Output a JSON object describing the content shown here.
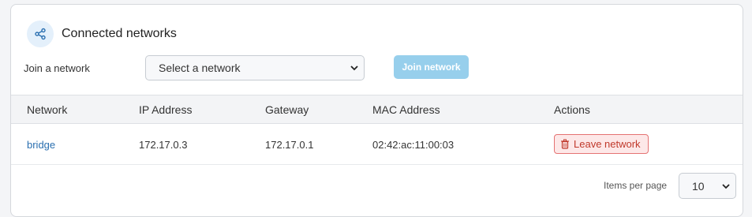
{
  "section": {
    "title": "Connected networks",
    "icon": "share-nodes-icon"
  },
  "join": {
    "label": "Join a network",
    "select_value": "Select a network",
    "button_label": "Join network"
  },
  "table": {
    "columns": [
      "Network",
      "IP Address",
      "Gateway",
      "MAC Address",
      "Actions"
    ],
    "rows": [
      {
        "network": "bridge",
        "ip": "172.17.0.3",
        "gateway": "172.17.0.1",
        "mac": "02:42:ac:11:00:03",
        "action_label": "Leave network"
      }
    ]
  },
  "pagination": {
    "items_per_page_label": "Items per page",
    "items_per_page_value": "10"
  },
  "colors": {
    "accent": "#2a6fb0",
    "join_button_bg": "#97cfec",
    "danger": "#c0392b",
    "danger_bg": "#fde8e8"
  }
}
